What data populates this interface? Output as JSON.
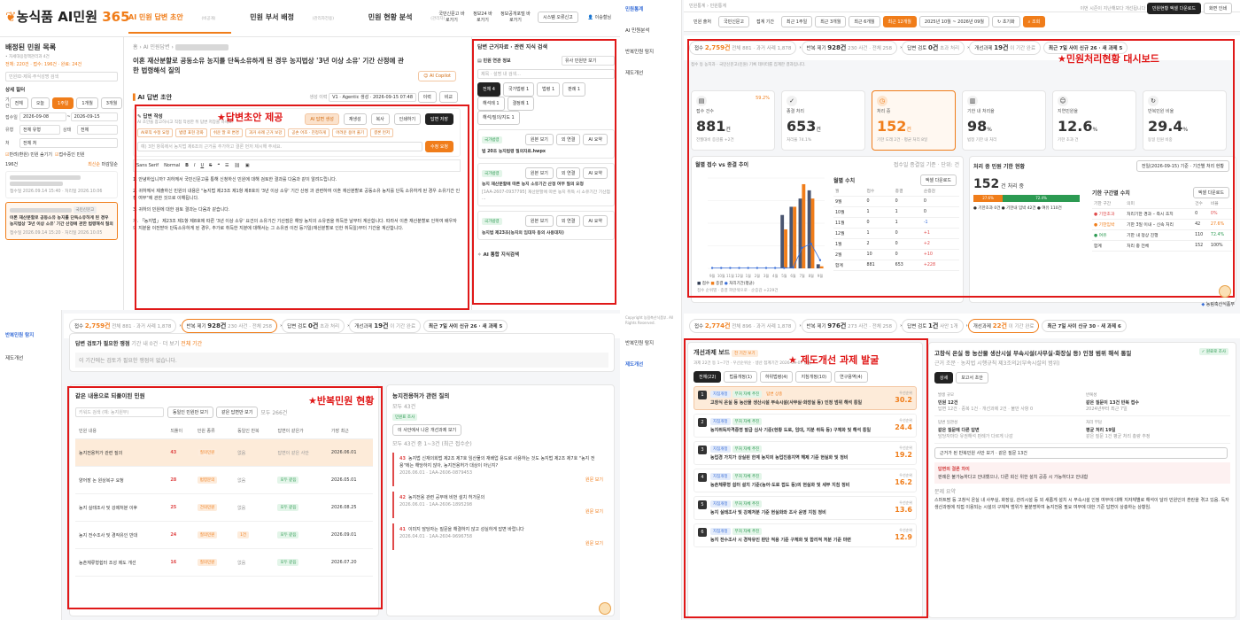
{
  "annotations": {
    "draft": "★답변초안 제공",
    "dashboard": "★민원처리현황 대시보드",
    "repeat": "★반복민원 현황",
    "reform": "★ 제도개선 과제 발굴"
  },
  "p1": {
    "logo_main": "농식품 AI민원",
    "logo_num": "365",
    "nav": [
      {
        "label": "AI 민원 답변 초안",
        "sub": "(비공개)"
      },
      {
        "label": "민원 부서 배정",
        "sub": "(관리자전용)"
      },
      {
        "label": "민원 현황 분석",
        "sub": "(관리자)"
      }
    ],
    "top_links": [
      "국민신문고 바로가기",
      "정보24 바로가기",
      "정보공개포털 바로가기",
      "시스템 오류신고",
      "이승철님"
    ],
    "left_title": "배정된 민원 목록",
    "left_sub": "• 자세대응정책관리과 4건",
    "counts": "전체: 220건 · 접수: 196건 · 완료: 24건",
    "search_placeholder": "민원ID·제목·주식성명 검색",
    "filter_title": "상세 필터",
    "period_label": "기간",
    "period_buttons": [
      "전체",
      "오늘",
      "1주일",
      "1개월",
      "3개월"
    ],
    "date_label": "접수일",
    "date_from": "2026-09-08",
    "date_to": "2026-09-15",
    "type_label": "유형",
    "type_value": "전체 유형",
    "status_label": "상태",
    "status_value": "전체",
    "dept_label": "처",
    "dept_value": "전체 처",
    "check1": "반려(환원) 민원 숨기기",
    "check2": "접수중인 민원",
    "list_count": "196건",
    "list_sort": "최신순",
    "list_sort2": "마감일순",
    "case1_date": "접수일 2026.09.14 15:40 · 처리일 2026.10.06",
    "case2_title": "이론 재산분할로 공동소유 농지를 단독소유하게 된 경우 농지법상 '3년 이상 소유' 기간 산정에 관한 법령해석 질의",
    "case2_tag": "국민신문고",
    "case2_date": "접수일 2026.09.14 15:20 · 처리일 2026.10.05",
    "breadcrumb": "홈 › AI 민원답변 › ",
    "page_title": "이혼 재산분할로 공동소유 농지를 단독소유하게 된 경우 농지법상 '3년 이상 소유' 기간 산정에 관한 법령해석 질의",
    "copilot": "AI Copilot",
    "draft_heading": "AI 답변 초안",
    "version_label": "생성 이력",
    "version_value": "V1 · Agentic 생성 · 2026-09-15 07:48",
    "history_btn": "이력",
    "compare_btn": "비교",
    "compose_title": "답변 작성",
    "compose_sub": "AI 초안을 참고하시고 직접 작성한 뒤 답변 저장을 하세요.",
    "compose_buttons": [
      "AI 답변 생성",
      "재생성",
      "복사",
      "인쇄하기",
      "답변 저장"
    ],
    "compose_chips": [
      "AI로직 수정 요청",
      "법령 표현 강화",
      "쉬운 말 로 변경",
      "과거 사례 근거 보강",
      "공손 어조 · 진정하게",
      "어려운 용어 풀기",
      "결론 먼저"
    ],
    "compose_input": "예) 3번 항목에서 농지법 제6조의 근거를 추가하고 결론 먼저 제시해 주세요.",
    "apply_btn": "수정 요청",
    "toolbar_font": "Sans Serif",
    "toolbar_size": "Normal",
    "paragraphs": [
      "1. 안녕하십니까? 귀하께서 국민신문고를 통해 신청하신 민원에 대해 검토한 결과를 다음과 같이 알려드립니다.",
      "2. 귀하께서 제출하신 민원의 내용은 \"농지법 제23조 제1항 제8호의 '3년 이상 소유' 기간 산정 과 관련하여 이혼 재산분할로 공동소유 농지를 단독 소유하게 된 경우 소유기간 인정 여부\"에 관한 것으로 이해됩니다.",
      "3. 귀하의 민원에 대한 검토 결과는 다음과 같습니다.",
      "가. 「농지법」 제23조 제1항 제8호에 따른 '3년 이상 소유' 요건의 소유기간 기산점은 해당 농지의 소유권을 취득한 날부터 계산합니다. 따라서 이혼 재산분할로 인하여 배우자의 지분을 이전받아 단독소유하게 된 경우, 추가로 취득한 지분에 대해서는 그 소유권 이전 등기일(재산분할로 인한 취득일)부터 기간을 계산합니다."
    ],
    "right_title": "답변 근거자료 · 관련 지식 검색",
    "right_sub": "민원 연관 정보",
    "right_select": "유사 민원만 보기",
    "right_search": "제목 · 설명 내 검색...",
    "right_filters": [
      "전체 4",
      "국가법령 1",
      "법령 1",
      "판례 1",
      "해석례 1",
      "결정례 1"
    ],
    "right_filter2": "해석/질의/지도 1",
    "ref1_title": "법 20조 농지법령 질의자료.hwpx",
    "ref2_title": "농지 재산분할에 따른 농지 소유기간 산정 여부 질의 요청",
    "ref2_text": "[1AA-2607-0937795] 재산분할에 따른 농지 취득 시 소유기간 기산점 ...",
    "ref3_title": "농지법 제23조(농지의 임대차 등의 사용대차)",
    "ref_tags": [
      "국가법령",
      "원본 보기",
      "외 연결",
      "AI 요약"
    ],
    "right_bottom": "AI 통합 지식검색"
  },
  "p2": {
    "side_items": [
      "민원통계",
      "AI 민원분석",
      "반복민원 탐지",
      "제도개선"
    ],
    "breadcrumb": "민원통계 › 민원통계",
    "top_right": [
      "이번 시즌이 지난해보다 개선됩니다",
      "민원현황 엑셀 다운로드",
      "화면 인쇄"
    ],
    "filters": [
      "민원 출처",
      "국민신문고",
      "접계 기간",
      "최근 1주일",
      "최근 3개월",
      "최근 6개월",
      "최근 12개월"
    ],
    "date_range": "2025년 10월 ~ 2026년 09월",
    "reset_btn": "초기화",
    "search_btn": "조회",
    "strip": [
      {
        "label": "접수",
        "value": "2,759건",
        "sub": "전체 881 · 과거 사례 1,878"
      },
      {
        "label": "반복 제기",
        "value": "928건",
        "sub": "230 사건 · 전체 258"
      },
      {
        "label": "답변 검토",
        "value": "0건",
        "sub": "초과 처리"
      },
      {
        "label": "개선과제",
        "value": "19건",
        "sub": "이 기간 완료"
      },
      {
        "label": "처리기한",
        "value": "최근 7일 사이 신규 26 · 새 과제 5",
        "sub": ""
      }
    ],
    "notice": "접수 등 농지과 · 국민신문고(민원) 기록 데이터를 집계한 결과입니다.",
    "metrics": [
      {
        "title": "접수 건수",
        "value": "881",
        "unit": "건",
        "note": "전월대비 증감률 +2건",
        "icon": "doc-icon",
        "rate": "59.2%"
      },
      {
        "title": "종결 처리",
        "value": "653",
        "unit": "건",
        "note": "처리율 74.1%",
        "icon": "check-icon"
      },
      {
        "title": "처리 중",
        "value": "152",
        "unit": "건",
        "note": "기한 도래 2건 · 평균 처리 8일",
        "icon": "clock-icon"
      },
      {
        "title": "기한 내 처리율",
        "value": "98",
        "unit": "%",
        "note": "법정 기한 내 처리",
        "icon": "chart-icon"
      },
      {
        "title": "지연민원율",
        "value": "12.6",
        "unit": "%",
        "note": "기한 초과 건",
        "icon": "user-icon"
      },
      {
        "title": "반복민원 비율",
        "value": "29.4",
        "unit": "%",
        "note": "동일 민원 비중",
        "icon": "repeat-icon"
      }
    ],
    "chart_title": "월별 접수 vs 종결 추이",
    "chart_note": "접수일 종결일 기준 · 단위: 건",
    "legend": [
      "접수",
      "종결",
      "처리기간(평균)"
    ],
    "footnote": "접수 순위별 · 종결 파란색으로 · 순증감 +229건",
    "month_title": "월별 수치",
    "month_btn": "엑셀 다운로드",
    "month_cols": [
      "월",
      "접수",
      "종결",
      "순증감"
    ],
    "month_rows": [
      [
        "9월",
        "0",
        "0",
        "0"
      ],
      [
        "10월",
        "1",
        "1",
        "0"
      ],
      [
        "11월",
        "0",
        "1",
        "-1"
      ],
      [
        "12월",
        "1",
        "0",
        "+1"
      ],
      [
        "1월",
        "2",
        "0",
        "+2"
      ],
      [
        "2월",
        "10",
        "0",
        "+10"
      ],
      [
        "합계",
        "881",
        "653",
        "+228"
      ]
    ],
    "due_title": "처리 중 민원 기한 현황",
    "due_note": "전일(2026-09-15) 기준 · 기간별 처리 현황",
    "due_total": "152",
    "due_total_unit": "건 처리 중",
    "due_bar_a": "27.6%",
    "due_bar_b": "72.4%",
    "due_legend": "● 기한초과 0건  ● 기한내 임박 42건  ● 여유 110건",
    "due_tbl_title": "기한 구간별 수치",
    "due_tbl_btn": "엑셀 다운로드",
    "due_cols": [
      "기한 구간",
      "의미",
      "건수",
      "비율"
    ],
    "due_rows": [
      [
        "● 기한초과",
        "처리기한 경과 – 즉시 조치",
        "0",
        "0%"
      ],
      [
        "● 기한임박",
        "기한 3일 이내 – 신속 처리",
        "42",
        "27.6%"
      ],
      [
        "● 여유",
        "기한 내 정상 진행",
        "110",
        "72.4%"
      ],
      [
        "합계",
        "처리 중 전체",
        "152",
        "100%"
      ]
    ],
    "brand": "농림축산식품부"
  },
  "p3": {
    "side_items": [
      "반복민원 탐지",
      "제도개선"
    ],
    "copyright": "Copyright 농림축산식품부. All Rights Reserved.",
    "strip": [
      {
        "label": "접수",
        "value": "2,759건",
        "sub": "전체 881 · 과거 사례 1,878"
      },
      {
        "label": "반복 제기",
        "value": "928건",
        "sub": "230 사건 · 전체 258"
      },
      {
        "label": "답변 검토",
        "value": "0건",
        "sub": "초과 처리"
      },
      {
        "label": "개선과제",
        "value": "19건",
        "sub": "이 기간 완료"
      },
      {
        "label": "처리기한",
        "value": "최근 7일 사이 신규 26 · 새 과제 5",
        "sub": ""
      }
    ],
    "review_title": "답변 검토가 필요한 쟁점",
    "review_sub": "기간 내 0건 · 더 보기",
    "review_link": "전체 기간",
    "review_empty": "이 기간에는 검토가 필요한 쟁점이 없습니다.",
    "repeat_title": "같은 내용으로 되풀이된 민원",
    "repeat_search": "키워드 검색 (예: 농지원부)",
    "repeat_buttons": [
      "동일인 민원만 보기",
      "같은 답변만 보기"
    ],
    "repeat_total": "모두 266건",
    "cols": [
      "민원 내용",
      "되풀이",
      "민원 종류",
      "동일인 반복",
      "답변이 같은가",
      "가장 최근"
    ],
    "rows": [
      {
        "text": "농지전용허가 관련 질의",
        "count": "43",
        "kind": "질의민원",
        "same": "없음",
        "ans": "답변이 같은 사안",
        "date": "2026.06.01",
        "hl": true
      },
      {
        "text": "양어장 논 원상복구 요청",
        "count": "28",
        "kind": "법령문의",
        "same": "없음",
        "ans": "모두 같음",
        "date": "2026.05.01",
        "hl": false
      },
      {
        "text": "농지 실태조사 및 강제처분 이후",
        "count": "25",
        "kind": "건의민원",
        "same": "없음",
        "ans": "모두 같음",
        "date": "2026.08.25",
        "hl": false
      },
      {
        "text": "농지 전수조사 및 경작유인 반대",
        "count": "24",
        "kind": "질의민원",
        "same": "1건",
        "ans": "모두 같음",
        "date": "2026.09.01",
        "hl": false
      },
      {
        "text": "농촌체류형쉼터 조성 제도 개선",
        "count": "16",
        "kind": "질의민원",
        "same": "없음",
        "ans": "모두 같음",
        "date": "2026.07.20",
        "hl": false
      }
    ],
    "detail_title": "농지전용허가 관련 질의",
    "detail_count": "모두 43건",
    "detail_tag": "민원표 조사",
    "detail_btn": "이 사안에서 나온 개선과제 보기",
    "detail_range": "모두 43건 중 1~3건 (최근 접수순)",
    "qa": [
      {
        "n": "43",
        "q": "농지법 신재의회법 제2조 제7호 임산물의 재배업 용도로 사용하는 것도 농지법 제2조 제7호 \"농지 전용\"에는 해당하지 않아, 농지전용허가 대상이 아닌지?",
        "meta": "2026.06.01 · 1AA-2606-0879453"
      },
      {
        "n": "42",
        "q": "농지전용 관련 공부에 비번 설치 허가문의",
        "meta": "2026.06.01 · 1AA-2606-1895298"
      },
      {
        "n": "41",
        "q": "이미지 담당자는 질문을 해결하지 않고 성실하게 답변 바랍니다",
        "meta": "2026.04.01 · 1AA-2604-9696758"
      }
    ],
    "more": "원문 보기"
  },
  "p4": {
    "strip": [
      {
        "label": "접수",
        "value": "2,774건",
        "sub": "전체 896 · 과거 사례 1,878"
      },
      {
        "label": "반복 제기",
        "value": "976건",
        "sub": "273 사건 · 전체 258"
      },
      {
        "label": "답변 검토",
        "value": "1건",
        "sub": "사안 1개"
      },
      {
        "label": "개선과제",
        "value": "22건",
        "sub": "이 기간 완료"
      },
      {
        "label": "처리기한",
        "value": "최근 7일 사이 신규 30 · 새 과제 6",
        "sub": ""
      }
    ],
    "board_title": "개선과제 보드",
    "board_tag": "전 기간 보기",
    "board_sub": "과제 22건 등 1~7건 · 우선순위순 · 생산 접계기간 2026-09-07 산출",
    "tabs": [
      "전체(22)",
      "법률개정(1)",
      "하위법령(4)",
      "지침개정(10)",
      "연구용역(4)"
    ],
    "tasks": [
      {
        "i": "1",
        "t": "고창식 온실 등 농산물 생산시설 부속시설(사무실·화장실 등) 인정 범위 해석 통일",
        "s": "30.2",
        "hl": true
      },
      {
        "i": "2",
        "t": "농지취득자격증명 발급 심사 기준(현황 도로, 임대, 지분 취득 등) 구체화 및 해석 통일",
        "s": "24.4",
        "hl": false
      },
      {
        "i": "3",
        "t": "농업경 가치가 상실된 한계 농지의 농업진흥지역 해제 기준 현실화 및 정비",
        "s": "19.2",
        "hl": false
      },
      {
        "i": "4",
        "t": "농촌체류형 쉼터 설치 기준(농어·도로 접도 등)의 현실화 및 세부 지침 정비",
        "s": "16.2",
        "hl": false
      },
      {
        "i": "5",
        "t": "농지 실태조사 및 강제처분 기준 현실화와 조사 운영 지침 정비",
        "s": "13.6",
        "hl": false
      },
      {
        "i": "6",
        "t": "농지 전수조사 시 경작유인 판단 적용 기준 구체화 및 합리적 처분 기준 마련",
        "s": "12.9",
        "hl": false
      }
    ],
    "task_tags": [
      "지침개정",
      "부처 자체 추진",
      "답변 상충"
    ],
    "score_label": "우선순위",
    "detail_title": "고창식 온실 등 농산물 생산시설 부속시설(사무실·화장실 등) 인정 범위 해석 통일",
    "detail_sub": "근거 조문 · 농지법 시행규칙 제3조의2(부속시설의 범위)",
    "detail_tag": "✓ 원료로 조사",
    "detail_tabs": [
      "상세",
      "보고서 초안"
    ],
    "grid": [
      {
        "k": "발생 규모",
        "v": "민원 12건",
        "s": "답변 12건 · 중복 1건 · 개선과제 2건 · 불만 사항 0"
      },
      {
        "k": "반복성",
        "v": "같은 질문이 13건 반복 접수",
        "s": "2024년부터 최근 7일"
      },
      {
        "k": "답변 일관성",
        "v": "같은 질문에 다른 답변",
        "s": "담당자마다 유권해석 판례가 다르게 나감"
      },
      {
        "k": "처리 부담",
        "v": "평균 처리 19일",
        "s": "같은 질문 1건 평균 처리 총량 추정"
      }
    ],
    "evidence_title": "근거가 된 반복민원 사안 보기 · 같은 질문 13건",
    "conflict_title": "답변의 결론 차이",
    "conflict_text": "판례은 불가능하다고 안내했으나, 다른 회신 위한 설치 공중 시 가능하다고 안내함",
    "problem_title": "문제 요약",
    "problem_text": "스마트팜 등 고창식 온실 내 사무실, 화장실, 관리시설 등 외 새롭게 설치 시 부속시설 인정 여부에 대해 지자체별로 해석이 달라 민원인의 혼란을 겪고 있음. 독자 생산과정에 직접 이용되는 시설의 구체적 범위가 불분명하여 농지전용 필요 여부에 대한 기준 답변이 상충하는 상황임.",
    "brand": "농림축산식품부"
  },
  "chart_data": {
    "type": "bar",
    "title": "월별 접수 vs 종결 추이",
    "categories": [
      "9월",
      "10월",
      "11월",
      "12월",
      "1월",
      "2월",
      "3월",
      "4월",
      "5월",
      "6월",
      "7월",
      "8월",
      "9월"
    ],
    "series": [
      {
        "name": "접수",
        "type": "bar",
        "values": [
          0,
          0,
          0,
          0,
          0,
          0,
          0,
          0,
          130,
          150,
          170,
          190,
          10
        ]
      },
      {
        "name": "종결",
        "type": "bar",
        "values": [
          0,
          0,
          0,
          0,
          0,
          0,
          0,
          0,
          95,
          150,
          205,
          170,
          5
        ]
      },
      {
        "name": "처리기간(평균)",
        "type": "line",
        "values": [
          1,
          1,
          1,
          1,
          1,
          1,
          1,
          1,
          1,
          2,
          50,
          60,
          20
        ]
      }
    ],
    "ylim": [
      0,
      220
    ],
    "grid": true,
    "legend": "bottom-left"
  }
}
